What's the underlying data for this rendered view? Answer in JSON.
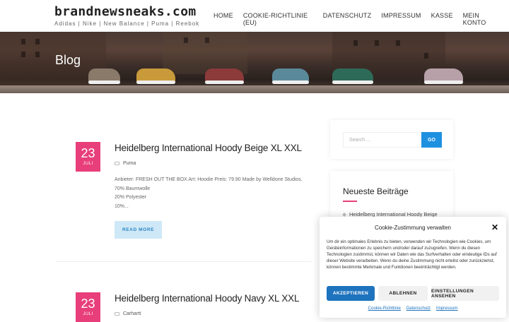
{
  "header": {
    "site_title": "brandnewsneaks.com",
    "tagline": "Adidas | Nike | New Balance | Puma | Reebok",
    "nav": [
      "HOME",
      "COOKIE-RICHTLINIE (EU)",
      "DATENSCHUTZ",
      "IMPRESSUM",
      "KASSE",
      "MEIN KONTO"
    ]
  },
  "hero": {
    "title": "Blog"
  },
  "posts": [
    {
      "day": "23",
      "month": "JULI",
      "title": "Heidelberg International Hoody Beige XL XXL",
      "category": "Puma",
      "excerpt_lines": [
        "Anbieter: FRESH OUT THE BOX Art: Hoodie Preis: 79.90 Made by Welldone Studios.",
        "70% Baumwolle",
        "20% Polyester",
        "10%..."
      ],
      "read_more": "READ MORE"
    },
    {
      "day": "23",
      "month": "JULI",
      "title": "Heidelberg International Hoody Navy XL XXL",
      "category": "Carhartt"
    }
  ],
  "sidebar": {
    "search_placeholder": "Search ...",
    "search_button": "GO",
    "recent_title": "Neueste Beiträge",
    "recent_items": [
      "Heidelberg International Hoody Beige"
    ]
  },
  "cookie": {
    "title": "Cookie-Zustimmung verwalten",
    "text": "Um dir ein optimales Erlebnis zu bieten, verwenden wir Technologien wie Cookies, um Geräteinformationen zu speichern und/oder darauf zuzugreifen. Wenn du diesen Technologien zustimmst, können wir Daten wie das Surfverhalten oder eindeutige IDs auf dieser Website verarbeiten. Wenn du deine Zustimmung nicht erteilst oder zurückziehst, können bestimmte Merkmale und Funktionen beeinträchtigt werden.",
    "accept": "AKZEPTIEREN",
    "deny": "ABLEHNEN",
    "prefs": "EINSTELLUNGEN ANSEHEN",
    "links": [
      "Cookie-Richtlinie",
      "Datenschutz",
      "Impressum"
    ]
  },
  "colors": {
    "accent_pink": "#e83e7a",
    "accent_blue": "#1e90e0",
    "cookie_blue": "#1e73be"
  }
}
